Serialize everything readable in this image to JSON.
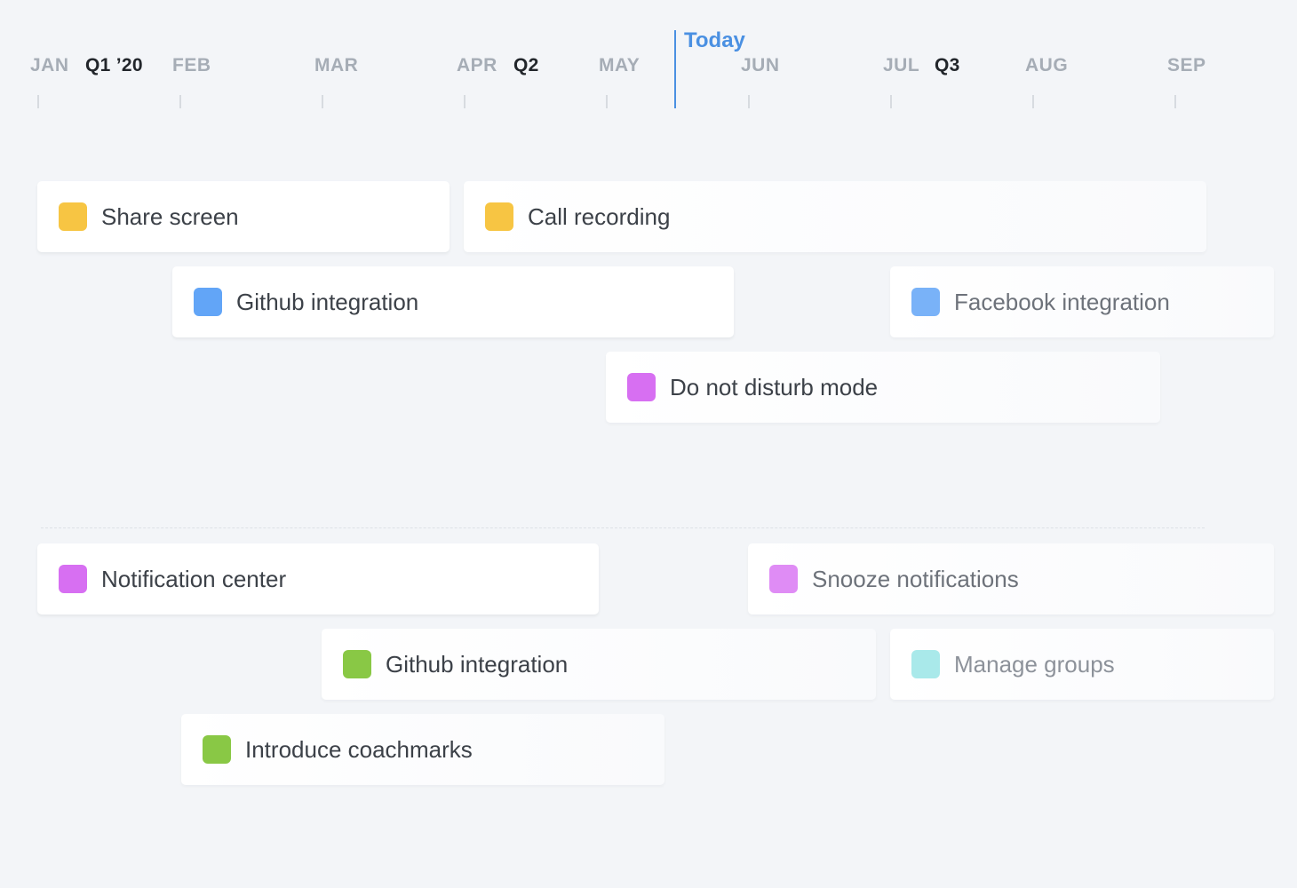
{
  "timeline": {
    "months": [
      "JAN",
      "FEB",
      "MAR",
      "APR",
      "MAY",
      "JUN",
      "JUL",
      "AUG",
      "SEP"
    ],
    "quarters": [
      "Q1 ’20",
      "Q2",
      "Q3"
    ],
    "today_label": "Today"
  },
  "colors": {
    "yellow": "#f7c543",
    "blue": "#62a5f7",
    "purple": "#d76ff2",
    "green": "#89c845",
    "teal": "#a9e9ea",
    "today": "#4a90e2"
  },
  "groups": [
    {
      "cards": [
        {
          "label": "Share screen",
          "color": "yellow"
        },
        {
          "label": "Call recording",
          "color": "yellow"
        },
        {
          "label": "Github integration",
          "color": "blue"
        },
        {
          "label": "Facebook integration",
          "color": "blue"
        },
        {
          "label": "Do not disturb mode",
          "color": "purple"
        }
      ]
    },
    {
      "cards": [
        {
          "label": "Notification center",
          "color": "purple"
        },
        {
          "label": "Snooze notifications",
          "color": "purple"
        },
        {
          "label": "Github integration",
          "color": "green"
        },
        {
          "label": "Manage groups",
          "color": "teal"
        },
        {
          "label": "Introduce coachmarks",
          "color": "green"
        }
      ]
    }
  ]
}
